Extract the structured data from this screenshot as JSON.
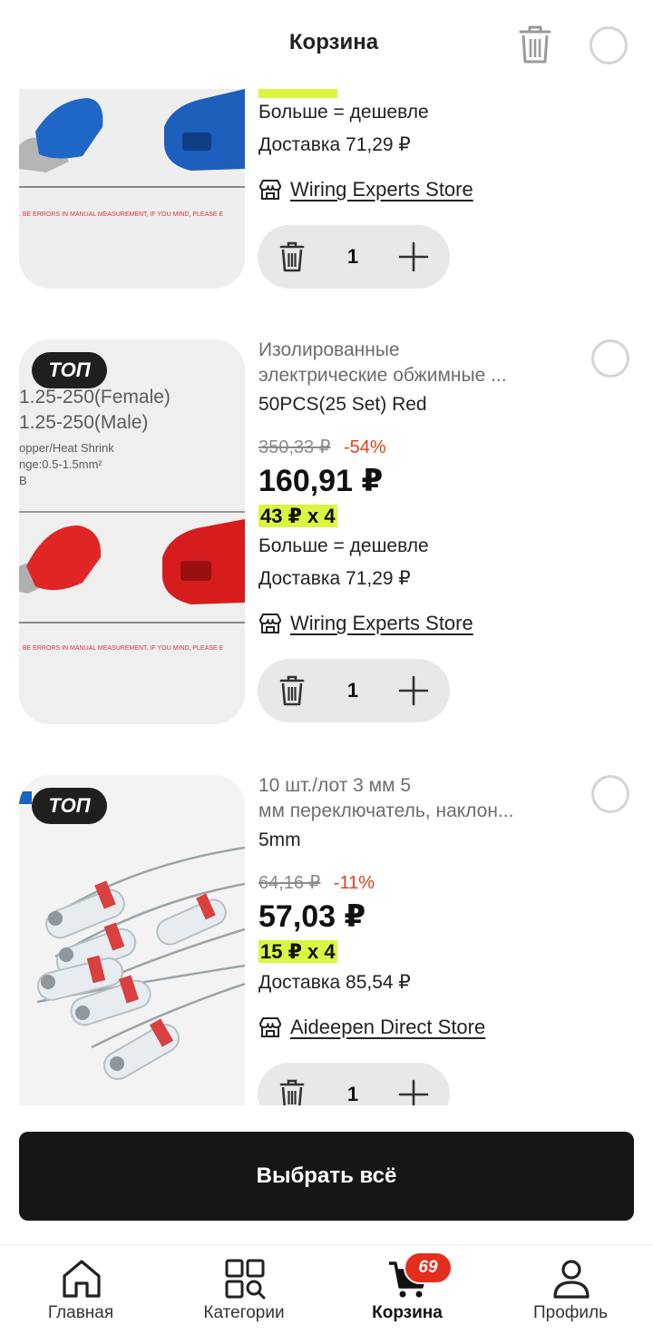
{
  "header": {
    "title": "Корзина"
  },
  "items": [
    {
      "title_line1": "",
      "title_line2": "",
      "variant": "",
      "old_price": "",
      "discount": "",
      "price": "",
      "per_unit": "",
      "bulk_text": "Больше = дешевле",
      "delivery": "Доставка 71,29 ₽",
      "store": "Wiring Experts Store",
      "quantity": "1",
      "badge": "",
      "image_caption": ". BE ERRORS IN MANUAL MEASUREMENT, IF YOU MIND, PLEASE E"
    },
    {
      "title_line1": "Изолированные",
      "title_line2": "электрические обжимные ...",
      "variant": "50PCS(25 Set) Red",
      "old_price": "350,33 ₽",
      "discount": "-54%",
      "price": "160,91 ₽",
      "per_unit": "43 ₽ x 4",
      "bulk_text": "Больше = дешевле",
      "delivery": "Доставка 71,29 ₽",
      "store": "Wiring Experts Store",
      "quantity": "1",
      "badge": "ТОП",
      "image_text_1": "1.25-250(Female)",
      "image_text_2": "1.25-250(Male)",
      "image_text_3": "opper/Heat Shrink",
      "image_text_4": "nge:0.5-1.5mm²",
      "image_text_5": "B",
      "image_caption": ". BE ERRORS IN MANUAL MEASUREMENT, IF YOU MIND, PLEASE E"
    },
    {
      "title_line1": "10 шт./лот 3 мм 5",
      "title_line2": "мм переключатель, наклон...",
      "variant": "5mm",
      "old_price": "64,16 ₽",
      "discount": "-11%",
      "price": "57,03 ₽",
      "per_unit": "15 ₽ x 4",
      "delivery": "Доставка 85,54 ₽",
      "store": "Aideepen Direct Store",
      "quantity": "1",
      "badge": "ТОП"
    }
  ],
  "select_all": "Выбрать всё",
  "tabs": [
    {
      "label": "Главная",
      "icon": "home-icon"
    },
    {
      "label": "Категории",
      "icon": "categories-icon"
    },
    {
      "label": "Корзина",
      "icon": "cart-icon",
      "badge": "69",
      "active": true
    },
    {
      "label": "Профиль",
      "icon": "profile-icon"
    }
  ],
  "colors": {
    "accent_badge": "#e52e1e",
    "highlight": "#dcf542",
    "discount": "#e0401a"
  }
}
